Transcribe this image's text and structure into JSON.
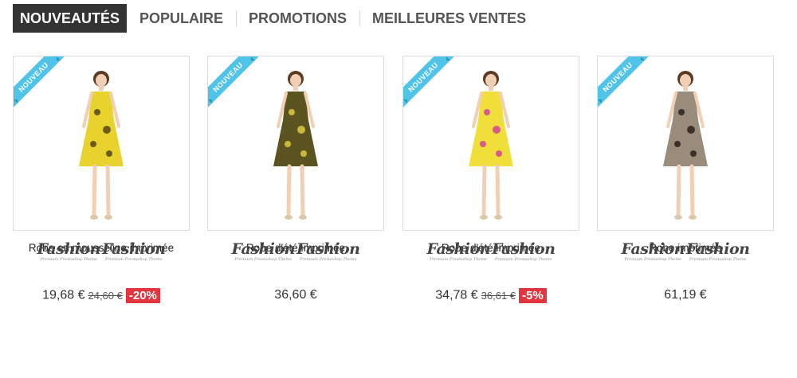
{
  "tabs": [
    {
      "label": "NOUVEAUTÉS",
      "active": true
    },
    {
      "label": "POPULAIRE",
      "active": false
    },
    {
      "label": "PROMOTIONS",
      "active": false
    },
    {
      "label": "MEILLEURES VENTES",
      "active": false
    }
  ],
  "ribbon_label": "NOUVEAU",
  "brand": {
    "word": "Fashion",
    "tagline": "Premium Prestashop Theme"
  },
  "products": [
    {
      "name": "Robe en mousseline imprimée",
      "price": "19,68 €",
      "old_price": "24,60 €",
      "discount": "-20%",
      "dress_color": "#e8d22e",
      "pattern_color": "#6b5a1a"
    },
    {
      "name": "Robe d'été imprimée",
      "price": "36,60 €",
      "old_price": "",
      "discount": "",
      "dress_color": "#5c5420",
      "pattern_color": "#c9b83a"
    },
    {
      "name": "Robe d'été imprimée",
      "price": "34,78 €",
      "old_price": "36,61 €",
      "discount": "-5%",
      "dress_color": "#f0df3a",
      "pattern_color": "#d65b8a"
    },
    {
      "name": "Robe imprimée",
      "price": "61,19 €",
      "old_price": "",
      "discount": "",
      "dress_color": "#9a8c7a",
      "pattern_color": "#3b3129"
    }
  ],
  "colors": {
    "accent_ribbon": "#4fc3e8",
    "discount_badge": "#e13540",
    "active_tab": "#333333"
  }
}
